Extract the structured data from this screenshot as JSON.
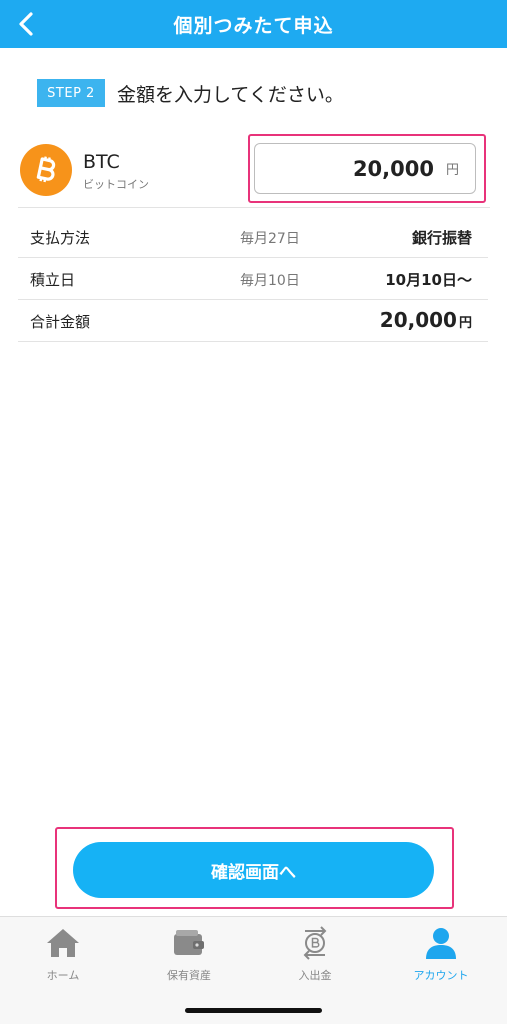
{
  "header": {
    "title": "個別つみたて申込"
  },
  "step": {
    "badge": "STEP 2",
    "instruction": "金額を入力してください。"
  },
  "coin": {
    "symbol": "BTC",
    "name": "ビットコイン",
    "icon": "bitcoin-icon"
  },
  "amount_input": {
    "value": "20,000",
    "unit": "円"
  },
  "details": {
    "payment": {
      "label": "支払方法",
      "mid": "毎月27日",
      "value": "銀行振替"
    },
    "date": {
      "label": "積立日",
      "mid": "毎月10日",
      "value": "10月10日〜"
    },
    "total": {
      "label": "合計金額",
      "value": "20,000",
      "unit": "円"
    }
  },
  "confirm_button": {
    "label": "確認画面へ"
  },
  "tabs": [
    {
      "label": "ホーム",
      "icon": "home-icon"
    },
    {
      "label": "保有資産",
      "icon": "wallet-icon"
    },
    {
      "label": "入出金",
      "icon": "deposit-withdraw-icon"
    },
    {
      "label": "アカウント",
      "icon": "account-icon"
    }
  ],
  "colors": {
    "primary": "#1eaaf1",
    "highlight": "#e8337a",
    "bitcoin": "#f7931a",
    "tab_active": "#1ea6ee"
  }
}
